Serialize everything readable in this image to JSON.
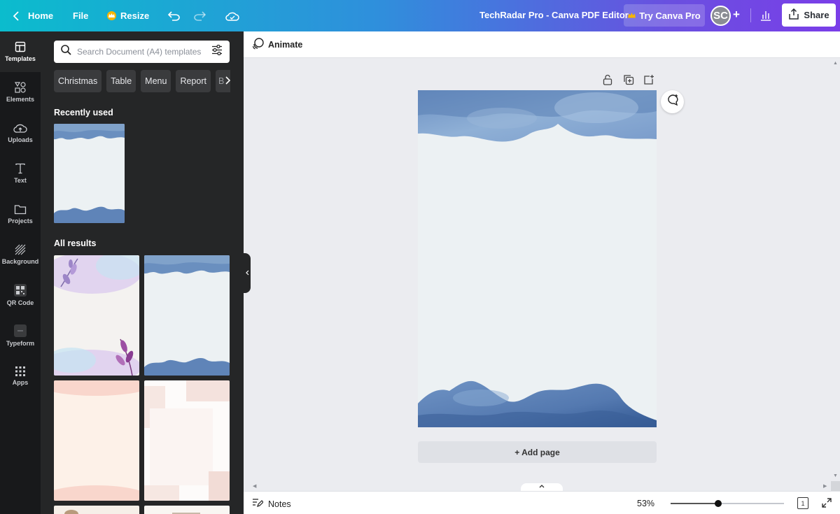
{
  "topbar": {
    "home_label": "Home",
    "file_label": "File",
    "resize_label": "Resize",
    "doc_title": "TechRadar Pro - Canva PDF Editor",
    "try_pro_label": "Try Canva Pro",
    "avatar_initials": "SC",
    "plus_label": "+",
    "share_label": "Share"
  },
  "rail": {
    "items": [
      {
        "label": "Templates",
        "icon": "layout-icon"
      },
      {
        "label": "Elements",
        "icon": "shapes-icon"
      },
      {
        "label": "Uploads",
        "icon": "upload-cloud-icon"
      },
      {
        "label": "Text",
        "icon": "text-icon"
      },
      {
        "label": "Projects",
        "icon": "folder-icon"
      },
      {
        "label": "Background",
        "icon": "background-pattern-icon"
      },
      {
        "label": "QR Code",
        "icon": "qr-code-icon"
      },
      {
        "label": "Typeform",
        "icon": "typeform-icon"
      },
      {
        "label": "Apps",
        "icon": "apps-grid-icon"
      }
    ]
  },
  "panel": {
    "search_placeholder": "Search Document (A4) templates",
    "chips": [
      "Christmas",
      "Table",
      "Menu",
      "Report",
      "B"
    ],
    "recently_used_title": "Recently used",
    "all_results_title": "All results"
  },
  "canvas": {
    "animate_label": "Animate",
    "add_page_label": "+ Add page"
  },
  "bottombar": {
    "notes_label": "Notes",
    "zoom_percent": "53%",
    "zoom_fraction": 0.42,
    "page_count": "1"
  },
  "colors": {
    "accent_gradient_start": "#0bbccd",
    "accent_gradient_end": "#7a3ee8",
    "watercolor_blue": "#5a7fb2"
  }
}
